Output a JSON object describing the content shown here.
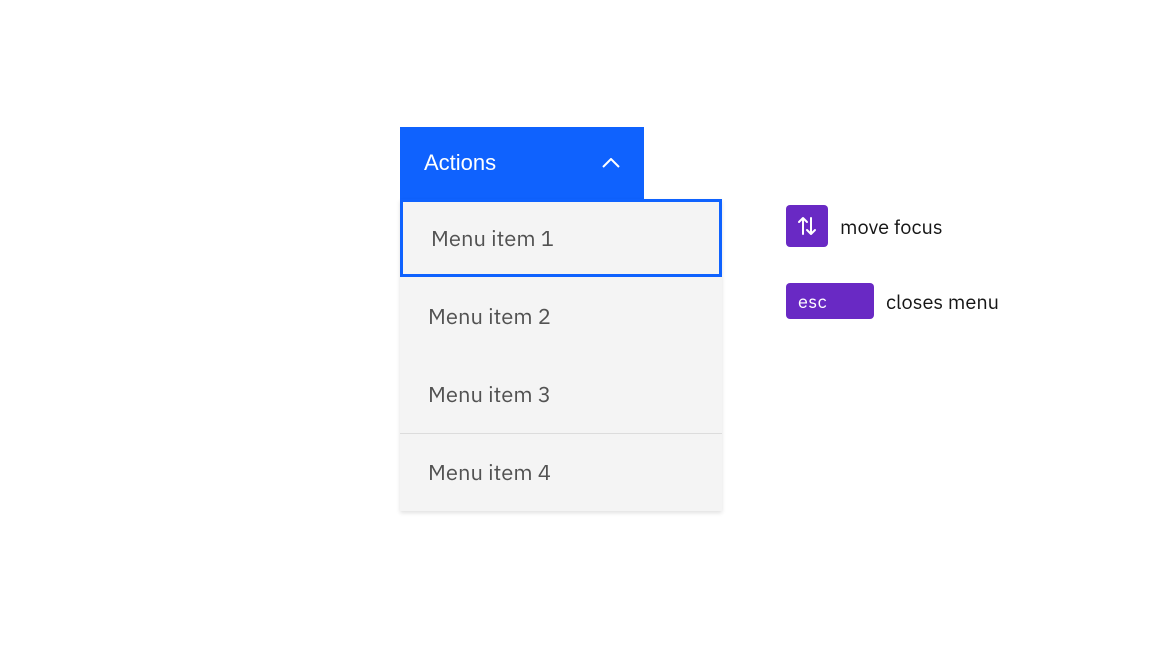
{
  "dropdown": {
    "button_label": "Actions",
    "items": [
      {
        "label": "Menu item 1",
        "focused": true
      },
      {
        "label": "Menu item 2",
        "focused": false
      },
      {
        "label": "Menu item 3",
        "focused": false
      },
      {
        "label": "Menu item 4",
        "focused": false
      }
    ]
  },
  "legend": {
    "arrows": {
      "key": "up-down-arrows",
      "description": "move focus"
    },
    "esc": {
      "key": "esc",
      "description": "closes menu"
    }
  },
  "colors": {
    "primary": "#0f62fe",
    "badge": "#6929c4",
    "menu_bg": "#f4f4f4",
    "text": "#525252",
    "legend_text": "#161616"
  }
}
